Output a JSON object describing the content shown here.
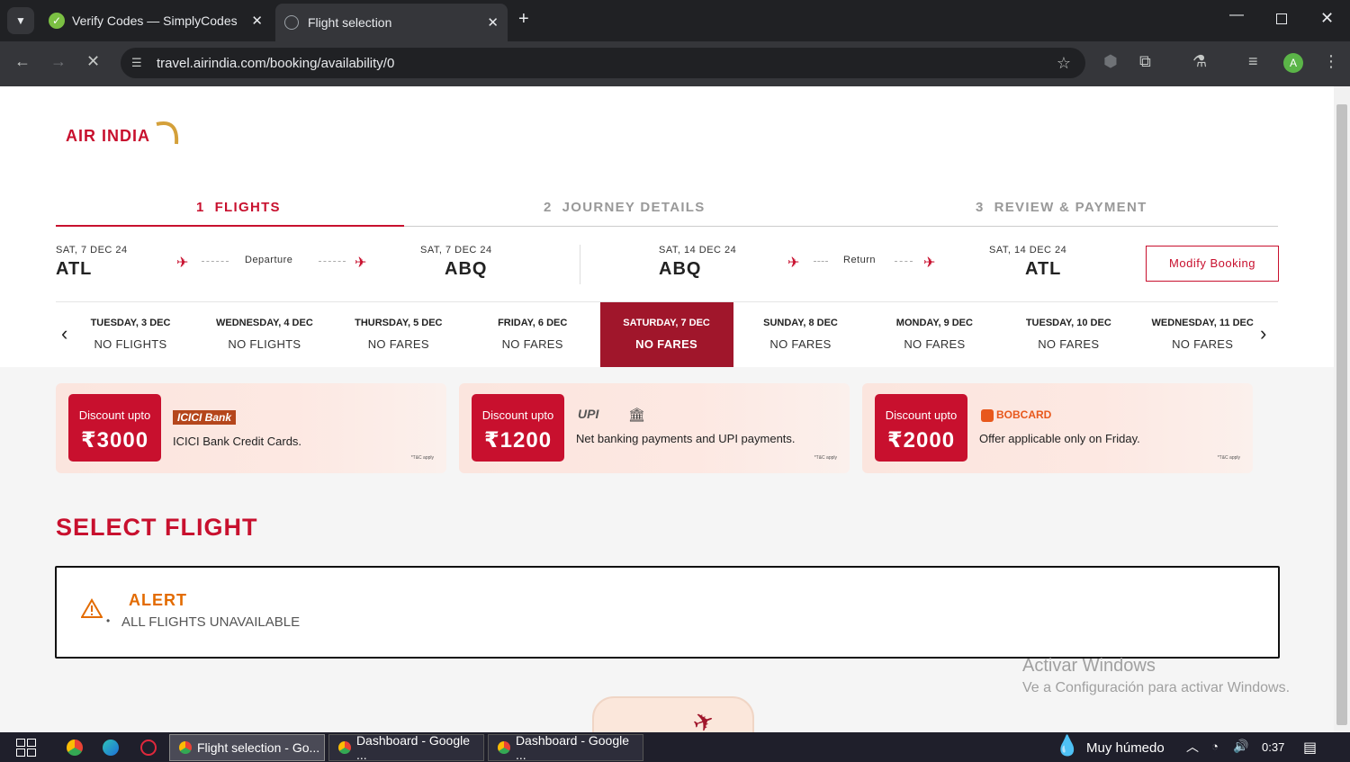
{
  "browser": {
    "tabs": [
      {
        "label": "Verify Codes — SimplyCodes",
        "active": false
      },
      {
        "label": "Flight selection",
        "active": true
      }
    ],
    "url": "travel.airindia.com/booking/availability/0",
    "profile_initial": "A"
  },
  "brand": {
    "logo_text": "AIR INDIA"
  },
  "steps": [
    {
      "num": "1",
      "label": "FLIGHTS"
    },
    {
      "num": "2",
      "label": "JOURNEY DETAILS"
    },
    {
      "num": "3",
      "label": "REVIEW & PAYMENT"
    }
  ],
  "trip": {
    "outbound": {
      "from_date": "SAT, 7 DEC 24",
      "from_code": "ATL",
      "label": "Departure",
      "to_date": "SAT, 7 DEC 24",
      "to_code": "ABQ"
    },
    "return": {
      "from_date": "SAT, 14 DEC 24",
      "from_code": "ABQ",
      "label": "Return",
      "to_date": "SAT, 14 DEC 24",
      "to_code": "ATL"
    },
    "modify_label": "Modify Booking"
  },
  "dates": [
    {
      "day": "TUESDAY, 3 DEC",
      "status": "NO FLIGHTS"
    },
    {
      "day": "WEDNESDAY, 4 DEC",
      "status": "NO FLIGHTS"
    },
    {
      "day": "THURSDAY, 5 DEC",
      "status": "NO FARES"
    },
    {
      "day": "FRIDAY, 6 DEC",
      "status": "NO FARES"
    },
    {
      "day": "SATURDAY, 7 DEC",
      "status": "NO FARES",
      "selected": true
    },
    {
      "day": "SUNDAY, 8 DEC",
      "status": "NO FARES"
    },
    {
      "day": "MONDAY, 9 DEC",
      "status": "NO FARES"
    },
    {
      "day": "TUESDAY, 10 DEC",
      "status": "NO FARES"
    },
    {
      "day": "WEDNESDAY, 11 DEC",
      "status": "NO FARES"
    }
  ],
  "offers": [
    {
      "badge_top": "Discount upto",
      "amount": "₹3000",
      "brand": "ICICI Bank",
      "desc": "ICICI Bank Credit Cards.",
      "tc": "*T&C apply"
    },
    {
      "badge_top": "Discount upto",
      "amount": "₹1200",
      "brand": "UPI",
      "desc": "Net banking payments and UPI payments.",
      "tc": "*T&C apply"
    },
    {
      "badge_top": "Discount upto",
      "amount": "₹2000",
      "brand": "BOBCARD",
      "desc": "Offer applicable only on Friday.",
      "tc": "*T&C apply"
    }
  ],
  "select_title": "SELECT FLIGHT",
  "alert": {
    "title": "ALERT",
    "message": "ALL FLIGHTS UNAVAILABLE"
  },
  "watermark": {
    "line1": "Activar Windows",
    "line2": "Ve a Configuración para activar Windows."
  },
  "taskbar": {
    "windows": [
      {
        "label": "Flight selection - Go...",
        "active": true
      },
      {
        "label": "Dashboard - Google ..."
      },
      {
        "label": "Dashboard - Google ..."
      }
    ],
    "weather": "Muy húmedo",
    "time": "0:37"
  },
  "colors": {
    "brand_red": "#c8102e",
    "selected_dark": "#a0162b",
    "alert_orange": "#e36b00"
  }
}
